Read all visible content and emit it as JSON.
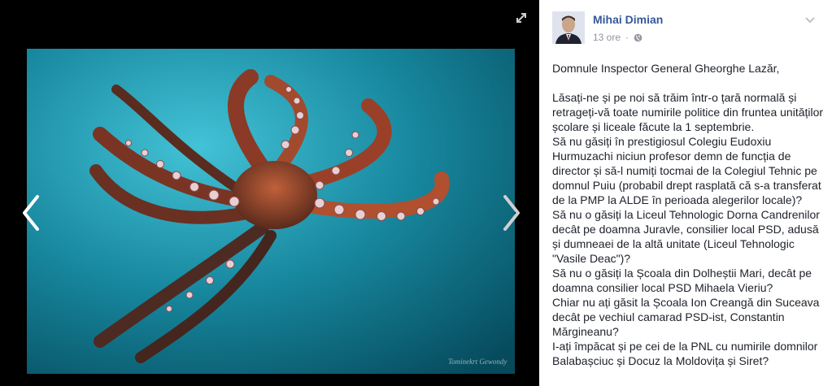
{
  "photo": {
    "alt": "Octopus photo",
    "watermark": "Tominekrt Gewondy"
  },
  "viewer": {
    "prev_icon": "chevron-left-icon",
    "next_icon": "chevron-right-icon",
    "expand_icon": "fullscreen-icon"
  },
  "post": {
    "author": "Mihai Dimian",
    "timestamp": "13 ore",
    "separator": "·",
    "privacy_icon": "globe-icon",
    "options_icon": "chevron-down-icon",
    "greeting": "Domnule Inspector General Gheorghe Lazăr,",
    "lines": [
      "Lăsați-ne și pe noi să trăim într-o țară normală și retrageți-vă toate numirile politice din fruntea unităților școlare și liceale făcute la 1 septembrie.",
      "Să nu găsiți în prestigiosul Colegiu Eudoxiu Hurmuzachi niciun profesor demn de funcția de director și să-l numiți tocmai de la Colegiul Tehnic pe domnul Puiu (probabil drept rasplată că s-a transferat de la PMP la ALDE în perioada alegerilor locale)?",
      "Să nu o găsiți la Liceul Tehnologic Dorna Candrenilor decât pe doamna Juravle, consilier local PSD, adusă și dumneaei de la altă unitate (Liceul Tehnologic \"Vasile Deac\")?",
      "Să nu o găsiți la Școala din Dolheștii Mari, decât pe doamna consilier local PSD Mihaela Vieriu?",
      "Chiar nu ați găsit la Școala Ion Creangă din Suceava decât pe vechiul camarad PSD-ist, Constantin Mărgineanu?",
      "I-ați împăcat și pe cei de la PNL cu numirile domnilor Balabașciuc și Docuz la Moldovița și Siret?"
    ]
  }
}
